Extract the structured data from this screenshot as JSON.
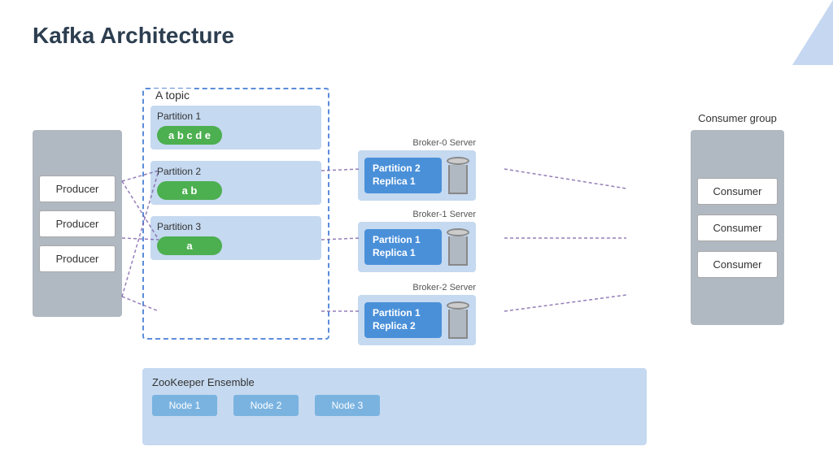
{
  "title": "Kafka Architecture",
  "deco": {
    "color": "#a0bce8"
  },
  "producers": {
    "label": "Producer",
    "items": [
      {
        "label": "Producer"
      },
      {
        "label": "Producer"
      },
      {
        "label": "Producer"
      }
    ]
  },
  "topic": {
    "label": "A topic",
    "partitions": [
      {
        "title": "Partition 1",
        "data": "a b c d e"
      },
      {
        "title": "Partition 2",
        "data": "a b"
      },
      {
        "title": "Partition 3",
        "data": "a"
      }
    ]
  },
  "brokers": [
    {
      "label": "Broker-0 Server",
      "replica_line1": "Partition 2",
      "replica_line2": "Replica 1"
    },
    {
      "label": "Broker-1 Server",
      "replica_line1": "Partition 1",
      "replica_line2": "Replica 1"
    },
    {
      "label": "Broker-2 Server",
      "replica_line1": "Partition 1",
      "replica_line2": "Replica 2"
    }
  ],
  "consumer_group": {
    "label": "Consumer group",
    "items": [
      {
        "label": "Consumer"
      },
      {
        "label": "Consumer"
      },
      {
        "label": "Consumer"
      }
    ]
  },
  "zookeeper": {
    "label": "ZooKeeper Ensemble",
    "nodes": [
      {
        "label": "Node 1"
      },
      {
        "label": "Node 2"
      },
      {
        "label": "Node 3"
      }
    ]
  }
}
